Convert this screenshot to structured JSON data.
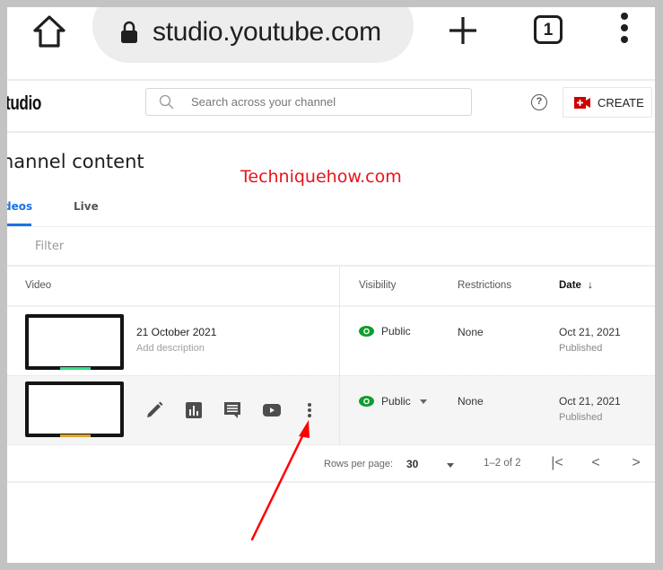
{
  "browser": {
    "url": "studio.youtube.com",
    "url_visible": "studio.youtube.com",
    "tab_count": "1",
    "icons": [
      "home-icon",
      "lock-icon",
      "new-tab-icon",
      "tabs-icon",
      "menu-icon"
    ]
  },
  "header": {
    "logo_text": "tudio",
    "search_placeholder": "Search across your channel",
    "help_icon": "?",
    "create_label": "CREATE"
  },
  "page": {
    "title": "hannel content",
    "watermark": "Techniquehow.com",
    "tabs": [
      {
        "label": "deos",
        "active": true
      },
      {
        "label": "Live",
        "active": false
      }
    ],
    "filter_label": "Filter"
  },
  "table": {
    "columns": {
      "video": "Video",
      "visibility": "Visibility",
      "restrictions": "Restrictions",
      "date": "Date",
      "date_sort_icon": "↓"
    },
    "rows": [
      {
        "title": "21 October 2021",
        "description": "Add description",
        "visibility": "Public",
        "restrictions": "None",
        "date": "Oct 21, 2021",
        "date_status": "Published"
      },
      {
        "title": "",
        "description": "",
        "visibility": "Public",
        "restrictions": "None",
        "date": "Oct 21, 2021",
        "date_status": "Published",
        "actions": [
          "edit",
          "analytics",
          "comments",
          "view-on-youtube",
          "options"
        ]
      }
    ]
  },
  "pagination": {
    "rows_per_page_label": "Rows per page:",
    "rows_per_page": "30",
    "range": "1–2 of 2",
    "first": "|<",
    "prev": "<",
    "next": ">"
  },
  "colors": {
    "accent": "#1a73e8",
    "public_green": "#0f9d2c",
    "create_red": "#cc0000",
    "watermark_red": "#e8141a",
    "arrow_red": "#ff0000"
  }
}
